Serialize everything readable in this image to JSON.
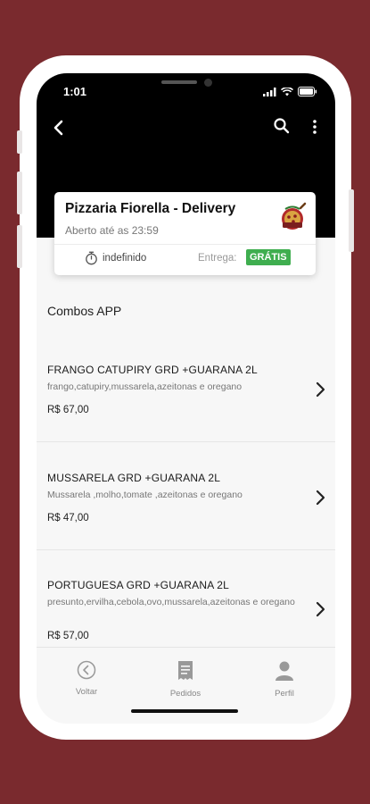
{
  "status": {
    "time": "1:01"
  },
  "restaurant": {
    "name": "Pizzaria Fiorella - Delivery",
    "hours": "Aberto até as 23:59",
    "time_estimate": "indefinido",
    "delivery_label": "Entrega:",
    "delivery_badge": "GRÁTIS"
  },
  "section": {
    "title": "Combos APP"
  },
  "items": [
    {
      "title": "FRANGO CATUPIRY GRD +GUARANA 2L",
      "desc": "frango,catupiry,mussarela,azeitonas e oregano",
      "price": "R$ 67,00"
    },
    {
      "title": "MUSSARELA GRD +GUARANA 2L",
      "desc": "Mussarela ,molho,tomate ,azeitonas e oregano",
      "price": "R$ 47,00"
    },
    {
      "title": "PORTUGUESA GRD +GUARANA 2L",
      "desc": "presunto,ervilha,cebola,ovo,mussarela,azeitonas e oregano",
      "price": "R$ 57,00"
    }
  ],
  "nav": [
    {
      "label": "Voltar",
      "icon": "back-circle-icon"
    },
    {
      "label": "Pedidos",
      "icon": "receipt-icon"
    },
    {
      "label": "Perfil",
      "icon": "person-icon"
    }
  ],
  "colors": {
    "background": "#7a2a2e",
    "badge": "#3fae4f",
    "header": "#000000"
  }
}
